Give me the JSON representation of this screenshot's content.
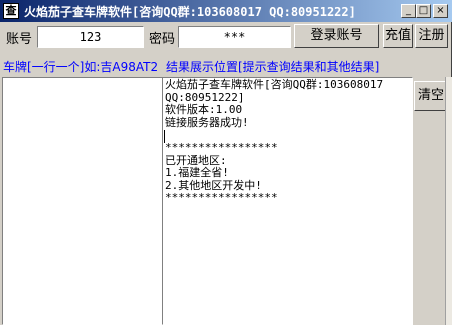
{
  "window": {
    "icon_glyph": "查",
    "title": "火焰茄子查车牌软件[咨询QQ群:103608017 QQ:80951222]",
    "minimize": "_",
    "maximize": "□",
    "close": "×"
  },
  "login": {
    "account_label": "账号",
    "account_value": "123",
    "password_label": "密码",
    "password_value": "***",
    "login_button": "登录账号",
    "recharge_button": "充值",
    "register_button": "注册"
  },
  "hints": {
    "plate_hint": "车牌[一行一个]如:吉A98AT2",
    "result_hint": "结果展示位置[提示查询结果和其他结果]"
  },
  "result": {
    "text": "火焰茄子查车牌软件[咨询QQ群:103608017\nQQ:80951222]\n软件版本:1.00\n链接服务器成功!\n\n*****************\n已开通地区:\n1.福建全省!\n2.其他地区开发中!\n*****************",
    "clear_button": "清空"
  }
}
